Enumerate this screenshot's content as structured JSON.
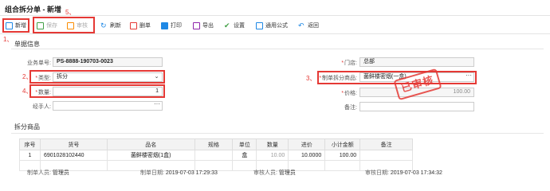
{
  "window": {
    "title": "组合拆分单 - 新增"
  },
  "toolbar": {
    "items": [
      {
        "label": "新增",
        "icon": "new-doc-icon",
        "color": "#1e88e5",
        "enabled": true
      },
      {
        "label": "保存",
        "icon": "save-icon",
        "color": "#43a047",
        "enabled": false
      },
      {
        "label": "审核",
        "icon": "check-icon",
        "color": "#fb8c00",
        "enabled": false
      },
      {
        "label": "刷新",
        "icon": "refresh-icon",
        "color": "#1e88e5",
        "enabled": true
      },
      {
        "label": "删单",
        "icon": "delete-doc-icon",
        "color": "#e53935",
        "enabled": true
      },
      {
        "label": "打印",
        "icon": "print-icon",
        "color": "#1e88e5",
        "enabled": true
      },
      {
        "label": "导出",
        "icon": "export-icon",
        "color": "#8e24aa",
        "enabled": true
      },
      {
        "label": "设置",
        "icon": "settings-icon",
        "color": "#43a047",
        "enabled": true
      },
      {
        "label": "通用公式",
        "icon": "formula-icon",
        "color": "#1e88e5",
        "enabled": true
      },
      {
        "label": "返回",
        "icon": "back-icon",
        "color": "#1e88e5",
        "enabled": true
      }
    ]
  },
  "annotations": {
    "a1": "1、",
    "a2": "2、",
    "a3": "3、",
    "a4": "4、",
    "a5": "5、"
  },
  "info": {
    "section_title": "单据信息",
    "doc_no_label": "业务单号:",
    "doc_no": "PS-8888-190703-0023",
    "type_label": "类型:",
    "type_value": "拆分",
    "qty_label": "数量:",
    "qty_value": "1",
    "handler_label": "经手人:",
    "handler_value": "",
    "store_label": "门店:",
    "store_value": "总部",
    "product_label": "制单拆分商品:",
    "product_value": "菌鲜楼密烟(一盒)",
    "price_label": "价格:",
    "price_value": "100.00",
    "remark_label": "备注:",
    "remark_value": ""
  },
  "stamp": {
    "text": "已审核"
  },
  "items": {
    "section_title": "拆分商品",
    "columns": [
      "序号",
      "货号",
      "品名",
      "规格",
      "单位",
      "数量",
      "进价",
      "小计金额",
      "备注"
    ],
    "rows": [
      [
        "1",
        "6901028102440",
        "菌鲜楼密烟(1盒)",
        "",
        "盒",
        "10.00",
        "10.0000",
        "100.00",
        ""
      ]
    ]
  },
  "footer": {
    "maker_label": "制单人员:",
    "maker": "管理员",
    "make_date_label": "制单日期:",
    "make_date": "2019-07-03 17:29:33",
    "auditor_label": "审核人员:",
    "auditor": "管理员",
    "audit_date_label": "审核日期:",
    "audit_date": "2019-07-03 17:34:32"
  }
}
